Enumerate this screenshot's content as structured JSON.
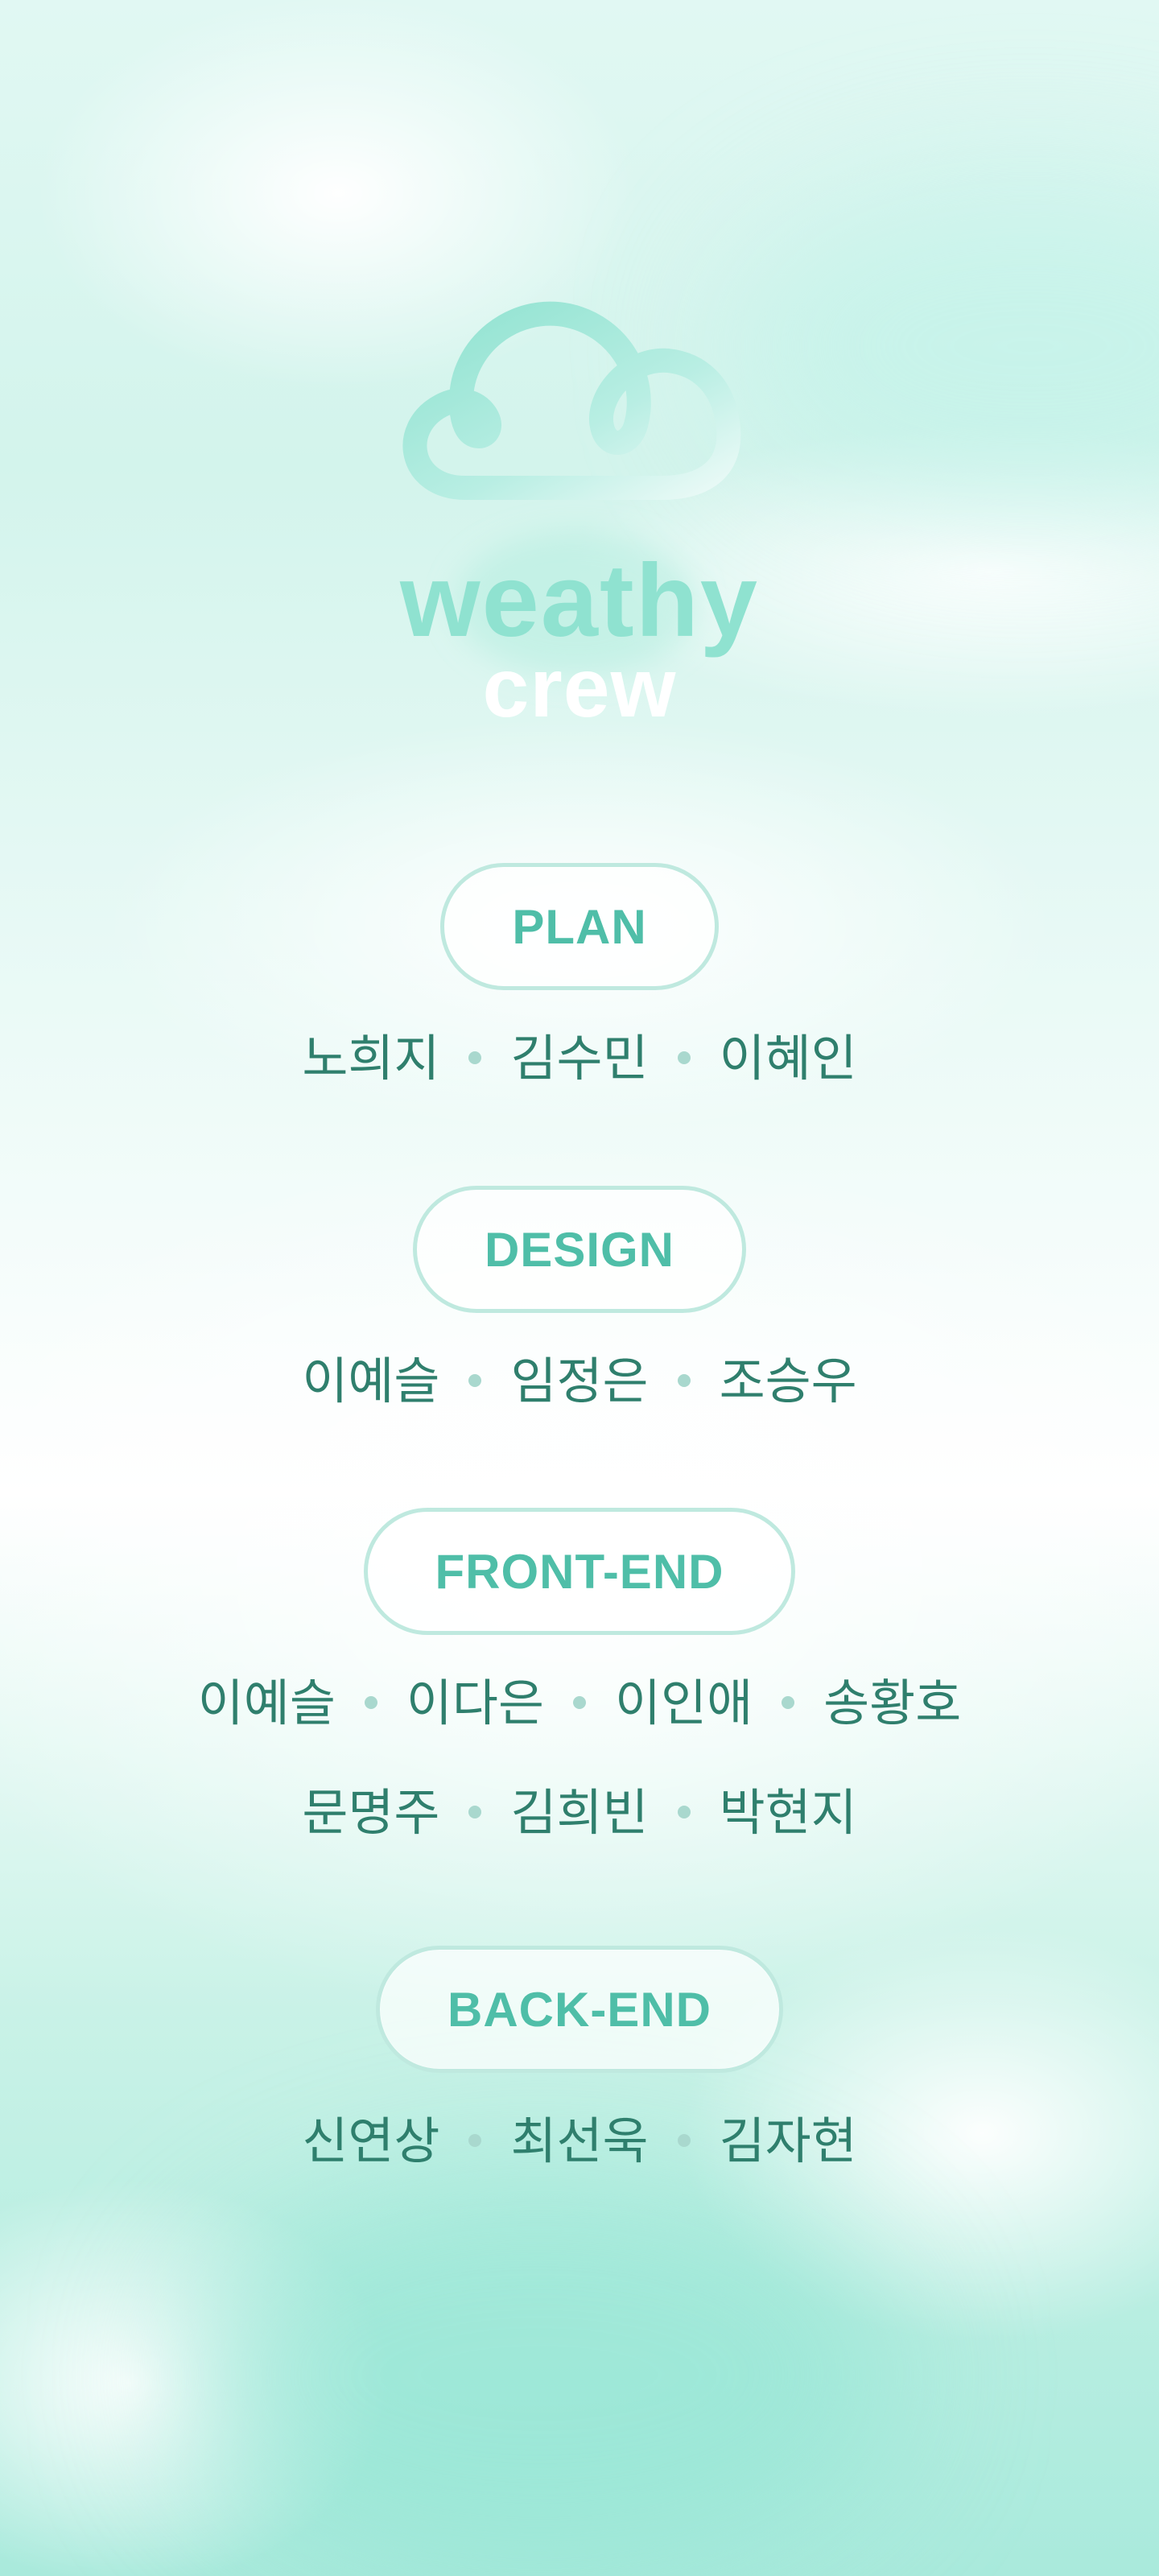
{
  "brand": {
    "title": "weathy",
    "subtitle": "crew",
    "colors": {
      "mint": "#8fe2d0",
      "mint_dark": "#4fbea8",
      "text_dark": "#2f7f6d",
      "white": "#ffffff"
    },
    "icon": "cloud-icon"
  },
  "sections": [
    {
      "title": "PLAN",
      "rows": [
        [
          "노희지",
          "김수민",
          "이혜인"
        ]
      ]
    },
    {
      "title": "DESIGN",
      "rows": [
        [
          "이예슬",
          "임정은",
          "조승우"
        ]
      ]
    },
    {
      "title": "FRONT-END",
      "rows": [
        [
          "이예슬",
          "이다은",
          "이인애",
          "송황호"
        ],
        [
          "문명주",
          "김희빈",
          "박현지"
        ]
      ]
    },
    {
      "title": "BACK-END",
      "rows": [
        [
          "신연상",
          "최선욱",
          "김자현"
        ]
      ]
    }
  ]
}
